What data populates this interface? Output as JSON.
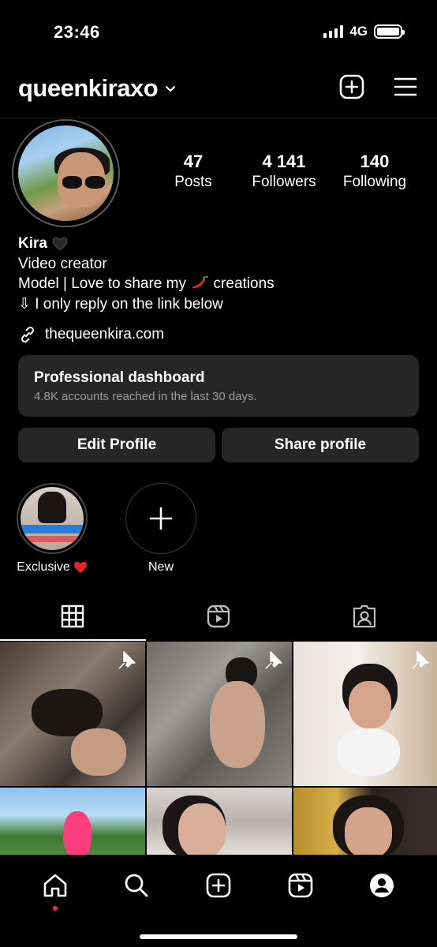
{
  "status": {
    "time": "23:46",
    "network": "4G",
    "battery_level": 1.0
  },
  "header": {
    "username": "queenkiraxo"
  },
  "stats": [
    {
      "value": "47",
      "label": "Posts"
    },
    {
      "value": "4 141",
      "label": "Followers"
    },
    {
      "value": "140",
      "label": "Following"
    }
  ],
  "bio": {
    "name": "Kira",
    "line1": "Video creator",
    "line2_before": "Model | Love to share my",
    "line2_after": "creations",
    "line3": "⇩ I only reply on the link below"
  },
  "link": {
    "text": "thequeenkira.com"
  },
  "dashboard": {
    "title": "Professional dashboard",
    "subtitle": "4.8K accounts reached in the last 30 days."
  },
  "buttons": {
    "edit": "Edit Profile",
    "share": "Share profile"
  },
  "highlights": [
    {
      "label": "Exclusive"
    },
    {
      "label": "New"
    }
  ],
  "tabs": [
    "posts-grid",
    "reels",
    "tagged"
  ],
  "nav": [
    "home",
    "search",
    "create",
    "reels",
    "profile"
  ]
}
